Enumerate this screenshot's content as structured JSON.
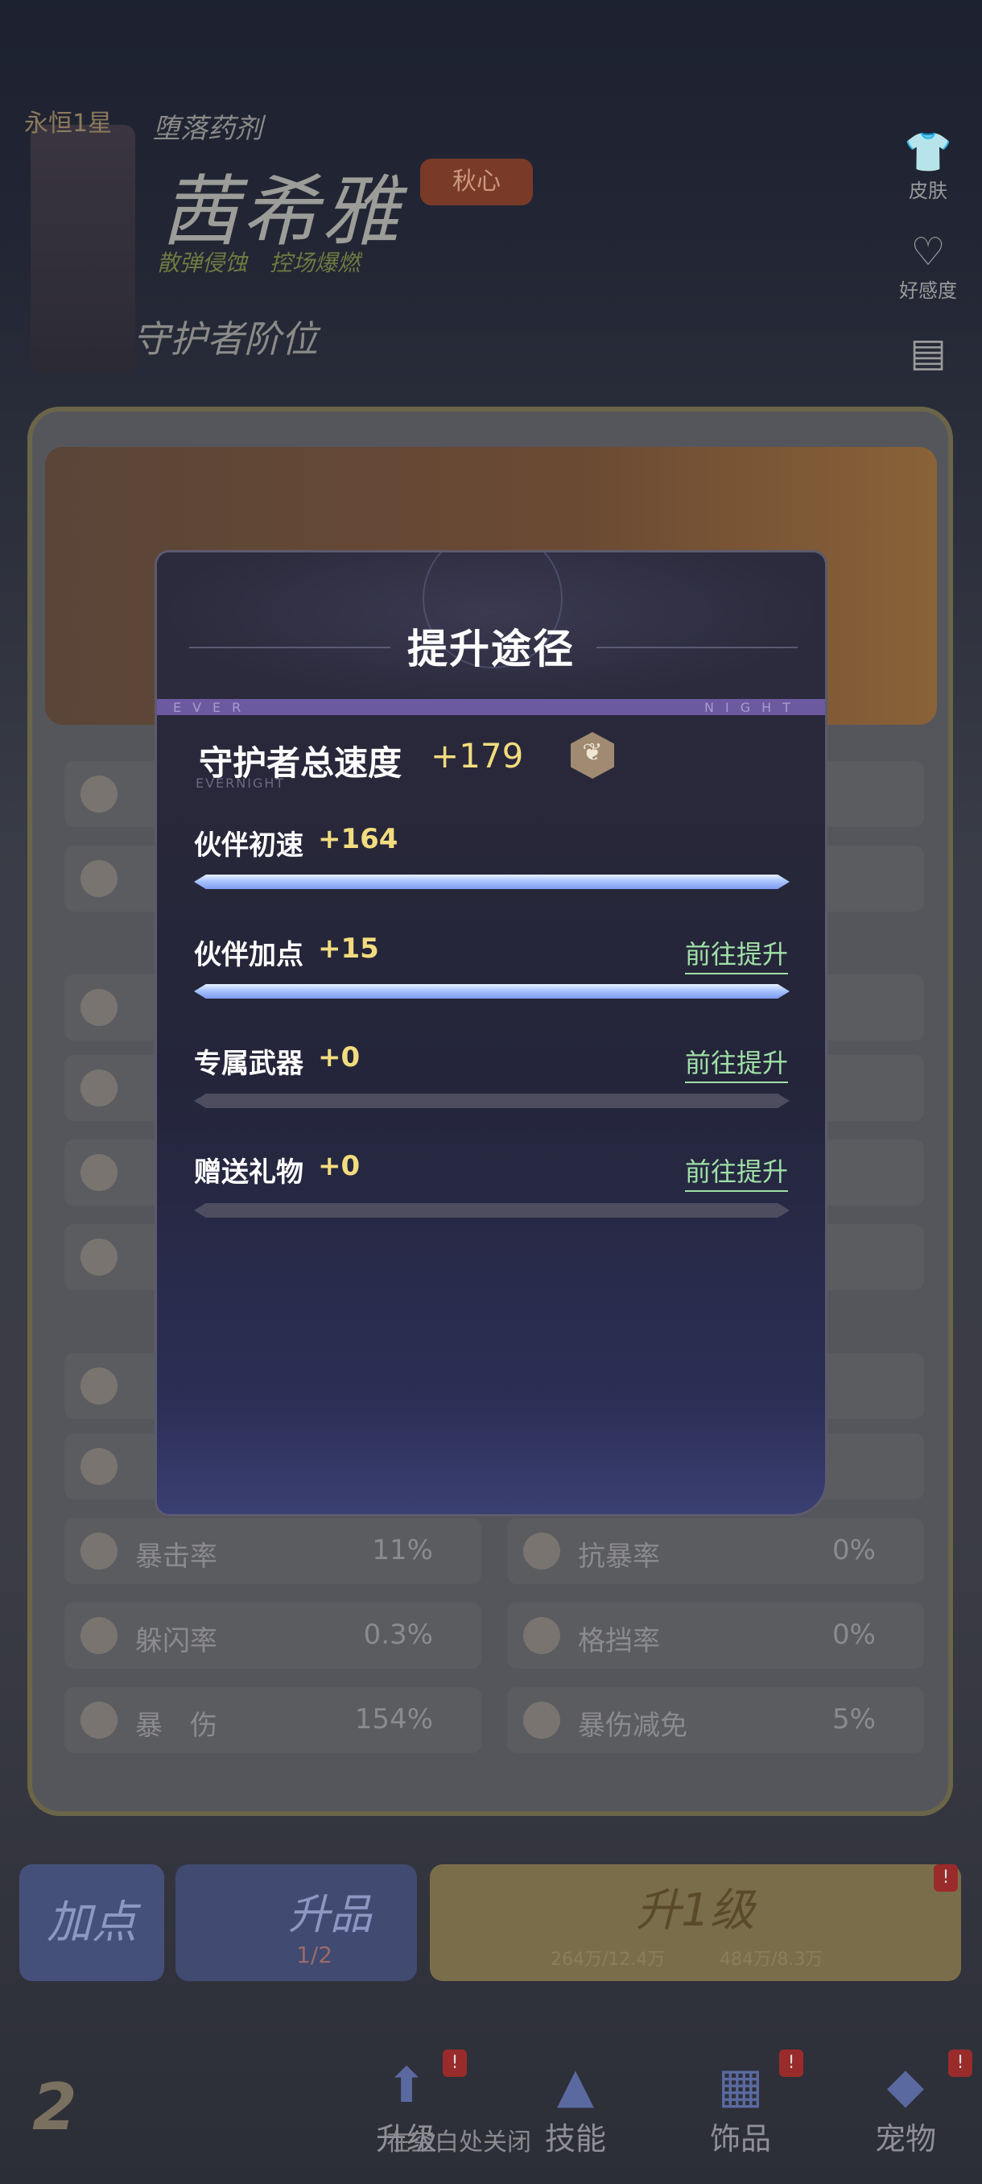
{
  "header": {
    "level": "永恒1星",
    "subtitle": "堕落药剂",
    "name": "茜希雅",
    "badge": "秋心",
    "tags": "散弹侵蚀　控场爆燃",
    "title": "守护者阶位"
  },
  "side_icons": [
    {
      "icon": "outfit-icon",
      "label": "皮肤"
    },
    {
      "icon": "affinity-icon",
      "label": "好感度"
    },
    {
      "icon": "archive-icon",
      "label": ""
    }
  ],
  "stats": {
    "rows": [
      {
        "label": "暴击率",
        "value": "11%"
      },
      {
        "label": "抗暴率",
        "value": "0%"
      },
      {
        "label": "躲闪率",
        "value": "0.3%"
      },
      {
        "label": "格挡率",
        "value": "0%"
      },
      {
        "label": "暴　伤",
        "value": "154%"
      },
      {
        "label": "暴伤减免",
        "value": "5%"
      }
    ]
  },
  "bottom_actions": {
    "add_points": "加点",
    "promote": "升品",
    "promote_progress": "1/2",
    "level_up": "升1级",
    "cost_1": "264万/12.4万",
    "cost_2": "484万/8.3万"
  },
  "nav": {
    "items": [
      {
        "label": "升级",
        "badge": "!"
      },
      {
        "label": "技能",
        "badge": ""
      },
      {
        "label": "饰品",
        "badge": "!"
      },
      {
        "label": "宠物",
        "badge": "!"
      }
    ],
    "toast": "在空白处关闭"
  },
  "modal": {
    "title": "提升途径",
    "stripe_left": "EVER",
    "stripe_right": "NIGHT",
    "watermark": "EVERNIGHT",
    "total_label": "守护者总速度",
    "total_value": "+179",
    "total_icon": "speed-wing-icon",
    "rows": [
      {
        "label": "伙伴初速",
        "value": "+164",
        "link": "",
        "progress": 1.0
      },
      {
        "label": "伙伴加点",
        "value": "+15",
        "link": "前往提升",
        "progress": 1.0
      },
      {
        "label": "专属武器",
        "value": "+0",
        "link": "前往提升",
        "progress": 0.0
      },
      {
        "label": "赠送礼物",
        "value": "+0",
        "link": "前往提升",
        "progress": 0.0
      }
    ]
  },
  "colors": {
    "accent_value": "#f2dc7e",
    "link_green": "#9fe0a6",
    "bar_fill": "#a9c4ff",
    "bar_empty": "#4e4d60"
  }
}
